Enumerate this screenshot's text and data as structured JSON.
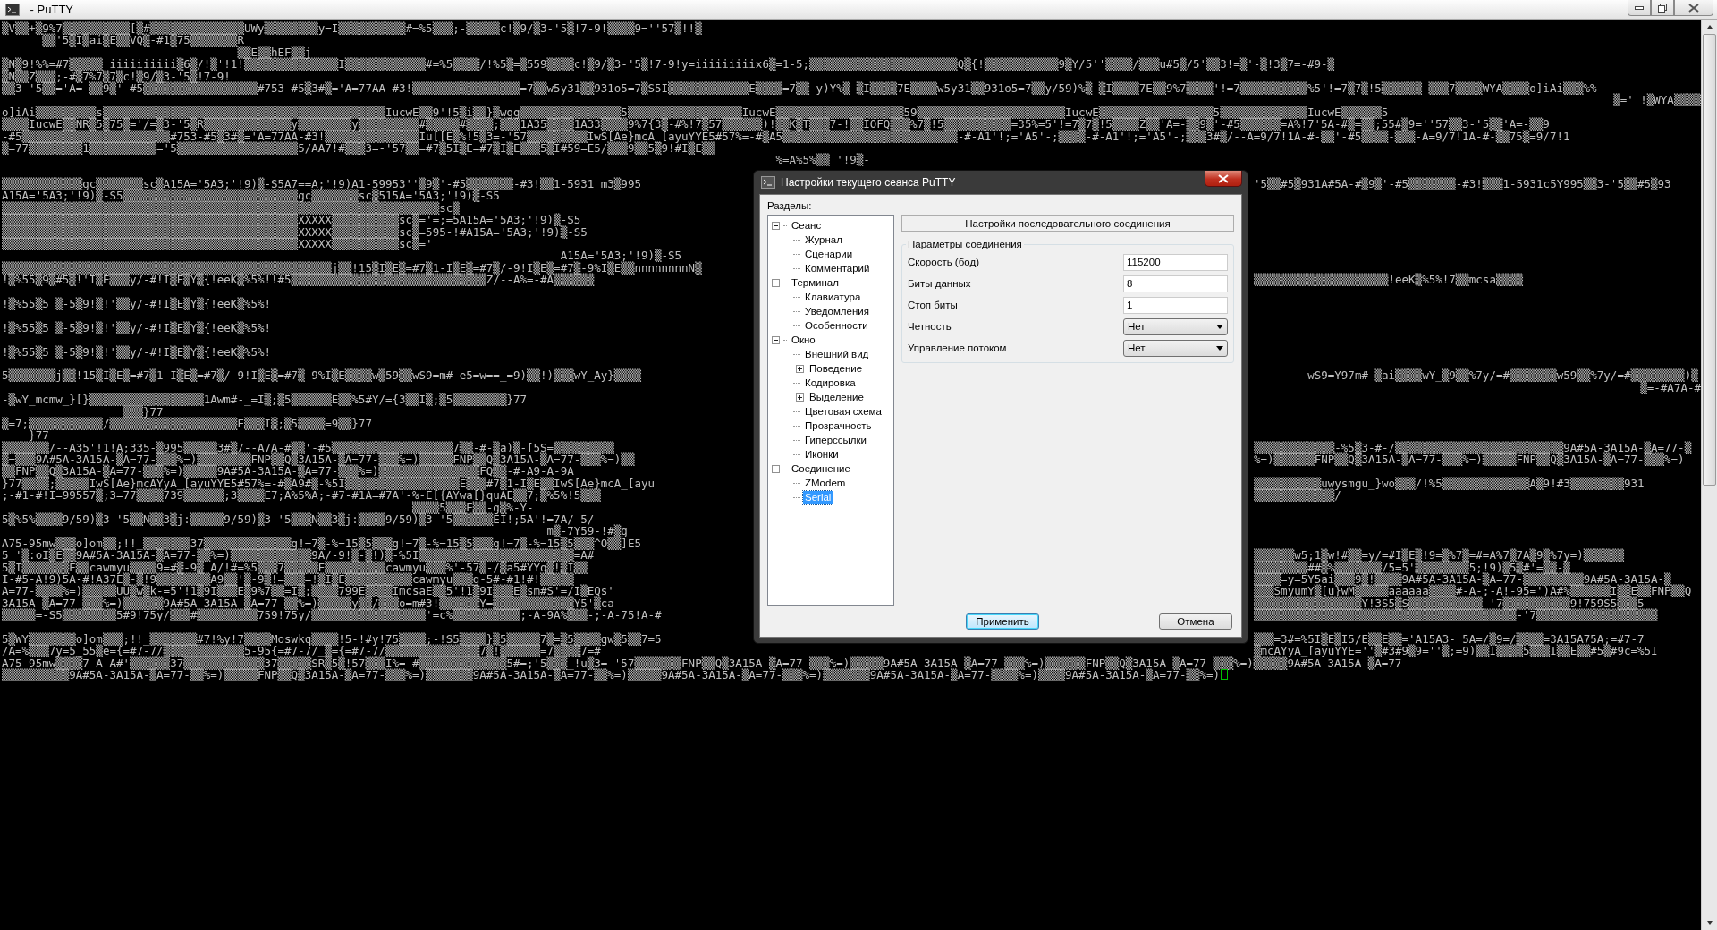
{
  "window": {
    "title": " - PuTTY"
  },
  "terminal": {
    "rows": [
      {
        "kind": "line",
        "text": "▒V▒▒+▒9%7▒▒▒▒▒▒▒▒▒▒[▒#▒▒▒▒▒▒▒▒▒▒▒▒▒▒UWy▒▒▒▒▒▒▒▒y=I▒▒▒▒▒▒▒▒▒▒#=%5▒▒▒;-▒▒▒▒▒c!▒9/▒3-'5▒!7-9!▒▒▒▒9=''57▒!!▒"
      },
      {
        "kind": "line",
        "text": "      ▒▒'5▒I▒ai▒E▒▒VQ▒-#1▒75▒▒▒▒▒▒▒R"
      },
      {
        "kind": "line",
        "text": "                                   ▒▒E▒▒hEF▒▒j"
      },
      {
        "kind": "line",
        "text": "▒N▒9!%%=#7▒▒▒▒▒ iiiiiiiiii▒6▒/!▒'!1!▒▒▒▒▒▒▒▒▒▒▒▒▒▒I▒▒▒▒▒▒▒▒▒▒▒▒#=%5▒▒▒▒/!%5▒=▒559▒▒▒▒c!▒9/▒3-'5▒!7-9!y=iiiiiiiiix6▒=1-5;▒▒▒▒▒▒▒▒▒▒▒▒▒▒▒▒▒▒▒▒▒▒Q▒{!▒▒▒▒▒▒▒▒▒▒▒9▒Y/5''▒▒▒▒/▒▒▒u#5▒/5'▒▒3!=▒'-▒!3▒7=-#9-▒"
      },
      {
        "kind": "line",
        "text": "▒N▒▒Z▒▒▒;-#▒7%7▒7▒c!▒9/▒3-'5▒!7-9!"
      },
      {
        "kind": "line",
        "text": "▒▒3-'5▒▒='A=-▒▒9▒'-#5▒▒▒▒▒▒▒▒▒▒▒▒▒▒▒▒▒#753-#5▒3#▒='A=77AA-#3!▒▒▒▒▒▒▒▒▒▒▒▒▒▒▒▒=7▒▒w5y31▒▒931o5=7▒S5I▒▒▒▒▒▒▒▒▒▒▒▒E▒▒▒▒=7▒▒-y)Y%▒-▒I▒▒▒▒7E▒▒▒▒w5y31▒▒931o5=7▒▒y/59)%▒-▒I▒▒▒▒7E▒▒9%7▒▒▒▒'!=7▒▒▒▒▒▒▒▒▒▒%5'!=7▒7▒!5▒▒▒▒▒▒-▒▒▒7▒▒▒▒WYA▒▒▒▒o]iAi▒▒▒%%"
      },
      {
        "kind": "right",
        "text": "▒=''!▒WYA▒▒▒▒"
      },
      {
        "kind": "line",
        "text": "o]iAi▒▒▒▒▒▒▒▒▒s▒▒▒▒▒▒▒▒▒▒▒▒▒▒▒▒▒▒▒▒▒▒▒▒▒▒▒▒▒▒▒▒▒▒▒▒▒▒▒▒▒▒IucwE▒▒9'!5▒i▒▒}▒wgg▒▒▒▒▒▒▒▒▒▒▒▒▒▒▒5▒▒▒▒▒▒▒▒▒▒▒▒▒▒▒▒▒IucwE▒▒▒▒▒▒▒▒▒▒▒▒▒▒▒▒▒▒▒59▒▒▒▒▒▒▒▒▒▒▒▒▒▒▒▒▒▒▒▒▒▒IucwE▒▒▒▒▒▒▒▒▒▒▒▒▒▒▒▒▒5▒▒▒▒▒▒▒▒▒▒▒▒▒IucwE▒▒▒▒▒▒5"
      },
      {
        "kind": "line",
        "text": "▒▒▒▒IucwE▒▒NR▒5▒75▒='/=▒3-'5▒R▒▒▒▒▒▒▒▒▒▒▒▒▒y▒▒▒▒▒▒▒▒y▒▒▒▒▒▒▒▒▒#▒▒▒▒▒#▒▒▒▒;▒▒▒1A35▒▒▒▒1A33▒▒▒▒9%7{3▒-#%!7▒57▒▒▒▒▒▒)!▒▒K▒T▒▒▒7-!▒▒IOFQ▒▒▒%7▒!5▒▒▒▒▒▒▒▒▒▒=35%=5'!=7▒7▒!5▒▒▒▒Z▒▒'A=-▒▒9▒'-#5▒▒▒▒▒▒=A%!7'5A-#▒=▒▒;55#▒9=''57▒▒3-'5▒▒'A=-▒▒9"
      },
      {
        "kind": "line",
        "text": "-#5▒▒▒▒▒▒▒▒▒▒▒▒▒▒▒▒▒▒▒▒▒▒#753-#5▒3#▒='A=77AA-#3!▒▒▒▒▒▒▒▒▒▒▒▒▒▒Iu[[E▒%!5▒3=-'57▒▒▒▒▒▒▒▒▒IwS[Ae}mcA_[ayuYYE5#57%=-#▒A5▒▒▒▒▒▒▒▒▒▒▒▒▒▒▒▒▒▒▒▒▒▒▒▒▒▒-#-A1'!;='A5'-;▒▒▒▒-#-A1'!;='A5'-;▒▒▒3#▒/--A=9/7!1A-#-▒▒'-#5▒▒▒▒-▒▒▒-A=9/7!1A-#-▒▒75▒=9/7!1"
      },
      {
        "kind": "line",
        "text": "▒=77▒▒▒▒▒▒▒▒1▒▒▒▒▒▒▒▒▒▒='5▒▒▒▒▒▒▒▒▒▒▒▒▒▒▒▒▒▒5/AA7!#▒▒▒3=-'57▒▒=#7▒5I▒E=#7▒I▒E▒▒▒5▒I#59=E5/▒▒▒9▒▒5▒9!#I▒E▒▒"
      },
      {
        "kind": "line",
        "text": "                                                                                                                   %=A%5%▒▒''!9▒-"
      },
      {
        "kind": "split",
        "spaced": true,
        "left": "▒▒▒▒▒▒▒▒▒▒▒▒gc▒▒▒▒▒▒▒sc▒A15A='5A3;'!9)▒-S5A7==A;'!9)A1-59953''▒9▒'-#5▒▒▒▒▒▒▒-#3!▒▒1-5931_m3▒995",
        "right": "'5▒▒#5▒931A#5A-#▒9▒'-#5▒▒▒▒▒▒▒-#3!▒▒▒1-5931c5Y995▒▒3-'5▒▒#5▒93"
      },
      {
        "kind": "split",
        "left": "A15A='5A3;'!9)▒-S5▒▒▒▒▒▒▒▒▒▒▒▒▒▒▒▒▒▒▒▒▒▒▒▒▒▒gc▒▒▒▒▒▒▒sc▒515A='5A3;'!9)▒-S5"
      },
      {
        "kind": "split",
        "left": "▒▒▒▒▒▒▒▒▒▒▒▒▒▒▒▒▒▒▒▒▒▒▒▒▒▒▒▒▒▒▒▒▒▒▒▒▒▒▒▒▒▒▒▒▒▒▒▒▒▒▒▒▒▒▒▒▒▒▒▒▒▒▒▒▒sc▒"
      },
      {
        "kind": "split",
        "left": "▒▒▒▒▒▒▒▒▒▒▒▒▒▒▒▒▒▒▒▒▒▒▒▒▒▒▒▒▒▒▒▒▒▒▒▒▒▒▒▒▒▒▒▒XXXXX▒▒▒▒▒▒▒▒▒▒sc▒='=;=5A15A='5A3;'!9)▒-S5"
      },
      {
        "kind": "split",
        "left": "▒▒▒▒▒▒▒▒▒▒▒▒▒▒▒▒▒▒▒▒▒▒▒▒▒▒▒▒▒▒▒▒▒▒▒▒▒▒▒▒▒▒▒▒XXXXX▒▒▒▒▒▒▒▒▒▒sc▒=595-!#A15A='5A3;'!9)▒-S5"
      },
      {
        "kind": "split",
        "left": "▒▒▒▒▒▒▒▒▒▒▒▒▒▒▒▒▒▒▒▒▒▒▒▒▒▒▒▒▒▒▒▒▒▒▒▒▒▒▒▒▒▒▒▒XXXXX▒▒▒▒▒▒▒▒▒▒sc▒='"
      },
      {
        "kind": "split",
        "left": "                                                                                   A15A='5A3;'!9)▒-S5"
      },
      {
        "kind": "split",
        "left": "▒▒▒▒▒▒▒▒▒▒▒▒▒▒▒▒▒▒▒▒▒▒▒▒▒▒▒▒▒▒▒▒▒▒▒▒▒▒▒▒▒▒▒▒▒▒▒▒▒j▒▒!15▒I▒E▒=#7▒1-I▒E▒=#7▒/-9!I▒E▒=#7▒-9%I▒E▒▒nnnnnnnnN▒"
      },
      {
        "kind": "split",
        "left": "!▒%55▒9▒#5▒!'I▒E▒▒▒y/-#!I▒E▒Y▒{!eeK▒%5%!!#5▒▒▒▒▒▒▒▒▒▒▒▒▒▒▒▒▒▒▒▒▒▒▒▒▒▒▒▒▒Z/--A%=-#A▒▒▒▒▒▒",
        "right": "▒▒▒▒▒▒▒▒▒▒▒▒▒▒▒▒▒▒▒▒!eeK▒%5%!7▒▒mcsa▒▒▒▒"
      },
      {
        "kind": "split",
        "spaced": true,
        "left": "!▒%55▒5 ▒-5▒9!▒!'▒▒y/-#!I▒E▒Y▒{!eeK▒%5%!"
      },
      {
        "kind": "split",
        "spaced": true,
        "left": "!▒%55▒5 ▒-5▒9!▒!'▒▒y/-#!I▒E▒Y▒{!eeK▒%5%!"
      },
      {
        "kind": "split",
        "spaced": true,
        "left": "!▒%55▒5 ▒-5▒9!▒!'▒▒y/-#!I▒E▒Y▒{!eeK▒%5%!"
      },
      {
        "kind": "split",
        "spaced": true,
        "left": "5▒▒▒▒▒▒▒j▒▒!15▒I▒E▒=#7▒1-I▒E▒=#7▒/-9!I▒E▒=#7▒-9%I▒E▒▒▒▒w▒59▒▒wS9=m#-e5=w==_=9)▒▒!)▒▒▒wY_Ay}▒▒▒▒",
        "right": "        wS9=Y97m#-▒ai▒▒▒▒wY_▒9▒▒%7y/=#▒▒▒▒▒▒▒w59▒▒%7y/=#▒▒▒▒▒▒▒▒)▒"
      },
      {
        "kind": "right",
        "text": "▒=-#A7A-#"
      },
      {
        "kind": "split",
        "left": "-▒wY_mcmw_}[}▒▒▒▒▒▒▒▒▒▒▒▒▒▒▒▒▒1Awm#-_=I▒;▒5▒▒▒▒▒▒E▒▒%5#Y/={3▒▒I▒;▒5▒▒▒▒▒▒▒▒}77"
      },
      {
        "kind": "split",
        "left": "                  ▒▒▒}77"
      },
      {
        "kind": "split",
        "left": "▒=7;▒▒▒▒▒▒▒▒▒▒▒/▒▒▒▒▒▒▒▒▒▒▒▒▒▒▒▒▒▒▒E▒▒▒I▒;▒5▒▒▒▒=9▒▒}77"
      },
      {
        "kind": "split",
        "left": "    }77"
      },
      {
        "kind": "split",
        "left": "▒▒▒▒▒▒▒/--A35'!1!A;335-▒995▒▒▒▒▒3#▒/--A7A-#▒▒'-#5▒▒▒▒▒▒▒▒▒▒▒▒▒▒▒▒▒▒7▒▒-#-▒a)▒-[5S=▒▒▒▒▒▒▒▒▒",
        "right": "▒▒▒▒▒▒▒▒▒▒▒▒-%5▒3-#-/▒▒▒▒▒▒▒▒▒▒▒▒▒▒▒▒▒▒▒▒▒▒▒▒▒9A#5A-3A15A-▒A=77-▒"
      },
      {
        "kind": "split",
        "left": "▒=▒▒▒9A#5A-3A15A-▒A=77-▒▒▒%=)▒▒▒▒▒▒▒▒FNP▒▒Q▒3A15A-▒A=77-▒▒▒%=)▒▒▒▒▒FNP▒▒Q▒3A15A-▒A=77-▒▒▒%=)▒▒",
        "right": "%=)▒▒▒▒▒▒FNP▒▒Q▒3A15A-▒A=77-▒▒▒%=)▒▒▒▒▒FNP▒▒Q▒3A15A-▒A=77-▒▒▒%=)"
      },
      {
        "kind": "split",
        "left": "▒▒FNP▒▒Q▒3A15A-▒A=77-▒▒▒%=)▒▒▒▒▒9A#5A-3A15A-▒A=77-▒▒▒%=)▒▒▒▒▒▒▒▒▒▒▒▒▒▒▒FQ▒▒-#-A9-A-9A"
      },
      {
        "kind": "split",
        "left": "}77▒▒▒▒;▒▒▒▒▒IwS[Ae}mcAYyA_[ayuYYE5#57%=-#▒A9#▒-%5I▒▒▒▒▒▒▒▒▒▒▒▒▒▒▒▒▒E▒▒▒#7▒1-I▒E▒▒IwS[Ae}mcA_[ayu",
        "right": "▒▒▒▒▒▒▒▒▒▒uwysmgu_}wo▒▒▒/!%5▒▒▒▒▒▒▒▒▒▒▒▒▒A▒9!#3▒▒▒▒▒▒▒▒931"
      },
      {
        "kind": "split",
        "left": ";-#1-#!I=99557▒;3=77▒▒▒▒739▒▒▒▒▒▒;3▒▒▒▒E7;A%5%A;-#7-#1A=#7A'-%-E[{AYwa[}quAE▒▒7;▒%5%!5▒▒▒",
        "right": "▒▒▒▒▒▒▒▒▒▒▒▒/"
      },
      {
        "kind": "split",
        "left": "                                                             ▒▒▒▒5▒▒▒E▒▒-g▒%-Y-"
      },
      {
        "kind": "split",
        "left": "5▒%5%▒▒▒▒9/59)▒3-'5▒▒N▒▒3▒j:▒▒▒▒▒9/59)▒3-'5▒▒▒N▒▒3▒j:▒▒▒▒9/59)▒3-'5▒▒▒▒▒▒EI!;5A'!=7A/-5/"
      },
      {
        "kind": "split",
        "left": "                                                                                 m▒-7Y59-!#▒g"
      },
      {
        "kind": "split",
        "left": "A75-95mw▒▒▒o]om▒▒;!!_▒▒▒▒▒▒▒37▒▒▒▒▒▒▒▒▒▒▒▒▒g!=7▒-%=15▒5▒▒▒g!=7▒-%=15▒5▒▒▒g!=7▒-%=15▒5▒▒▒^O▒▒]E5"
      },
      {
        "kind": "split",
        "left": "5_'▒:oI▒E▒▒9A#5A-3A15A-▒A=77-▒▒%=)▒▒▒▒▒▒▒▒▒▒▒▒9A/-9!▒-▒!)▒-%5I▒▒▒▒▒▒▒▒▒▒▒▒▒▒▒▒▒▒▒▒▒▒▒=A#",
        "right": "▒▒▒▒▒▒w5;1▒w!#▒▒=y/=#I▒E▒!9=▒%7▒=#=A%7▒7A▒9▒%7y=)▒▒▒▒▒▒"
      },
      {
        "kind": "split",
        "left": "5▒I▒▒▒▒▒▒▒E▒▒cawmyu▒▒▒▒9=#▒-9▒'A/!#=%5▒▒▒7▒▒▒▒▒E▒▒▒▒▒▒▒▒▒cawmyu▒▒▒%'-57▒-/▒a5#YYq▒!▒I▒▒",
        "right": "▒▒▒▒▒▒▒▒##▒%▒▒▒▒▒▒▒/5=5'▒▒▒▒▒▒▒▒5;!9)▒5▒#'=▒▒-▒"
      },
      {
        "kind": "split",
        "left": "I-#5-A!9)5A-#!A37E▒-▒!9▒▒▒▒▒▒▒▒A9▒▒'▒-9▒!=▒▒▒=!▒I▒E▒▒▒▒▒▒▒▒▒▒cawmyu▒▒▒g-5#-#1!#!▒▒▒▒▒",
        "right": "▒▒▒▒=y=5Y5ai▒▒▒9▒!▒▒▒▒9A#5A-3A15A-▒A=77-▒▒▒▒▒▒▒▒▒9A#5A-3A15A-▒"
      },
      {
        "kind": "split",
        "left": "A=77-▒▒▒▒%=)▒▒▒▒▒UU▒w▒k-=5'!1▒9I▒▒▒E▒9%7▒▒=I▒;▒▒▒▒799E▒▒▒▒ImcsaE▒▒5'!1▒9I▒▒▒E▒sm#S'=/I▒EQs'",
        "right": "▒▒▒SmyumY▒[u}wM▒▒▒▒▒aaaaaa▒▒▒▒#-A-;-A!-95=')A#%▒▒▒▒▒▒I▒▒E▒▒FNP▒▒Q"
      },
      {
        "kind": "split",
        "left": "3A15A-▒A=77-▒▒▒%=)▒▒▒▒▒▒9A#5A-3A15A-▒A=77-▒▒%=)▒▒▒▒▒y▒▒/▒▒▒o=m#3!▒▒▒▒▒▒Y=▒▒▒▒▒▒▒▒▒▒▒▒Y5'▒ca",
        "right": "▒▒▒▒▒▒▒▒▒▒▒▒▒▒▒▒Y!3S5▒S▒▒▒▒▒▒▒▒▒▒▒-'7▒▒▒▒▒▒▒▒▒▒9!759S5▒▒▒5"
      },
      {
        "kind": "split",
        "left": "▒▒▒▒▒=-S5▒▒▒▒▒▒▒▒5#9!75y/▒▒▒#▒▒▒▒▒▒▒▒▒759!75y/▒▒▒▒▒▒▒▒▒▒▒▒▒▒▒▒▒'=c%▒▒▒▒▒▒▒▒▒▒;-A-9A%▒▒▒-;-A-75!A-#",
        "right": "▒▒▒▒▒▒▒▒▒▒▒▒▒▒▒▒▒▒▒▒▒▒▒▒▒▒▒▒▒▒▒▒▒▒▒▒▒▒▒-'7▒▒▒▒▒▒▒▒▒▒▒▒▒▒▒▒▒▒"
      },
      {
        "kind": "split",
        "spaced": true,
        "left": "5▒WY▒▒▒▒▒▒▒o]om▒▒▒;!!_▒▒▒▒▒▒▒#7!%y!7▒▒▒▒Moswkq▒▒▒▒!5-!#y!75▒▒▒▒;-!S5▒▒▒▒}▒5▒▒▒▒▒7▒=▒5▒▒▒▒gw▒5▒▒7=5",
        "right": "▒▒▒=3#=%5I▒E▒I5/E▒▒E▒▒='A15A3-'5A=/▒9=/▒▒▒▒=3A15A75A;=#7-7"
      },
      {
        "kind": "split",
        "left": "/A=%▒▒▒7y=5_55▒e={=#7-7/▒▒▒▒▒▒▒▒▒▒▒▒5-95{=#7-7/_▒={=#7-7/▒▒▒▒▒▒▒▒▒▒▒▒▒▒7▒!▒▒▒▒▒▒=7▒▒▒▒7=#",
        "right": "▒mcAYyA_[ayuYYE=''▒#3#9▒9=''▒;=9)▒▒I▒▒▒▒5▒▒▒I▒▒E▒▒#5▒#9c=%5I"
      },
      {
        "kind": "line",
        "text": "A75-95mw▒▒▒▒7-A-A#'▒▒▒▒▒▒37▒▒▒▒▒▒▒▒▒▒▒▒37▒▒▒▒▒SR▒5▒!57▒▒▒I%=-#▒▒▒▒▒▒▒▒▒▒▒▒▒5#=;'5▒▒▒_!u▒3=-'57▒▒▒▒▒▒▒FNP▒▒Q▒3A15A-▒A=77-▒▒▒%=)▒▒▒▒▒9A#5A-3A15A-▒A=77-▒▒▒%=)▒▒▒▒▒▒FNP▒▒Q▒3A15A-▒A=77-▒▒▒%=)▒▒▒▒▒9A#5A-3A15A-▒A=77-"
      },
      {
        "kind": "line",
        "cursor": true,
        "text": "▒▒▒▒▒▒▒▒▒▒9A#5A-3A15A-▒A=77-▒▒%=)▒▒▒▒▒FNP▒▒Q▒3A15A-▒A=77-▒▒▒%=)▒▒▒▒▒▒▒9A#5A-3A15A-▒A=77-▒▒%=)▒▒▒▒▒9A#5A-3A15A-▒A=77-▒▒▒%=)▒▒▒▒▒▒▒9A#5A-3A15A-▒A=77-▒▒▒▒%=)▒▒▒▒9A#5A-3A15A-▒A=77-▒▒%=)"
      }
    ]
  },
  "dialog": {
    "title": "Настройки текущего сеанса PuTTY",
    "sections_label": "Разделы:",
    "tree": [
      {
        "label": "Сеанс",
        "expanded": true,
        "selected": false,
        "children": [
          {
            "label": "Журнал",
            "selected": false
          },
          {
            "label": "Сценарии",
            "selected": false
          },
          {
            "label": "Комментарий",
            "selected": false
          }
        ]
      },
      {
        "label": "Терминал",
        "expanded": true,
        "selected": false,
        "children": [
          {
            "label": "Клавиатура",
            "selected": false
          },
          {
            "label": "Уведомления",
            "selected": false
          },
          {
            "label": "Особенности",
            "selected": false
          }
        ]
      },
      {
        "label": "Окно",
        "expanded": true,
        "selected": false,
        "children": [
          {
            "label": "Внешний вид",
            "selected": false
          },
          {
            "label": "Поведение",
            "expanded": false,
            "selected": false
          },
          {
            "label": "Кодировка",
            "selected": false
          },
          {
            "label": "Выделение",
            "expanded": false,
            "selected": false
          },
          {
            "label": "Цветовая схема",
            "selected": false
          },
          {
            "label": "Прозрачность",
            "selected": false
          },
          {
            "label": "Гиперссылки",
            "selected": false
          },
          {
            "label": "Иконки",
            "selected": false
          }
        ]
      },
      {
        "label": "Соединение",
        "expanded": true,
        "selected": false,
        "children": [
          {
            "label": "ZModem",
            "selected": false
          },
          {
            "label": "Serial",
            "selected": true
          }
        ]
      }
    ],
    "panel_title": "Настройки последовательного соединения",
    "group": {
      "title": "Параметры соединения",
      "fields": [
        {
          "kind": "text",
          "label": "Скорость (бод)",
          "value": "115200"
        },
        {
          "kind": "text",
          "label": "Биты данных",
          "value": "8"
        },
        {
          "kind": "text",
          "label": "Стоп биты",
          "value": "1"
        },
        {
          "kind": "select",
          "label": "Четность",
          "value": "Нет"
        },
        {
          "kind": "select",
          "label": "Управление потоком",
          "value": "Нет"
        }
      ]
    },
    "buttons": [
      {
        "label": "Применить",
        "default": true
      },
      {
        "label": "Отмена",
        "default": false
      }
    ]
  }
}
